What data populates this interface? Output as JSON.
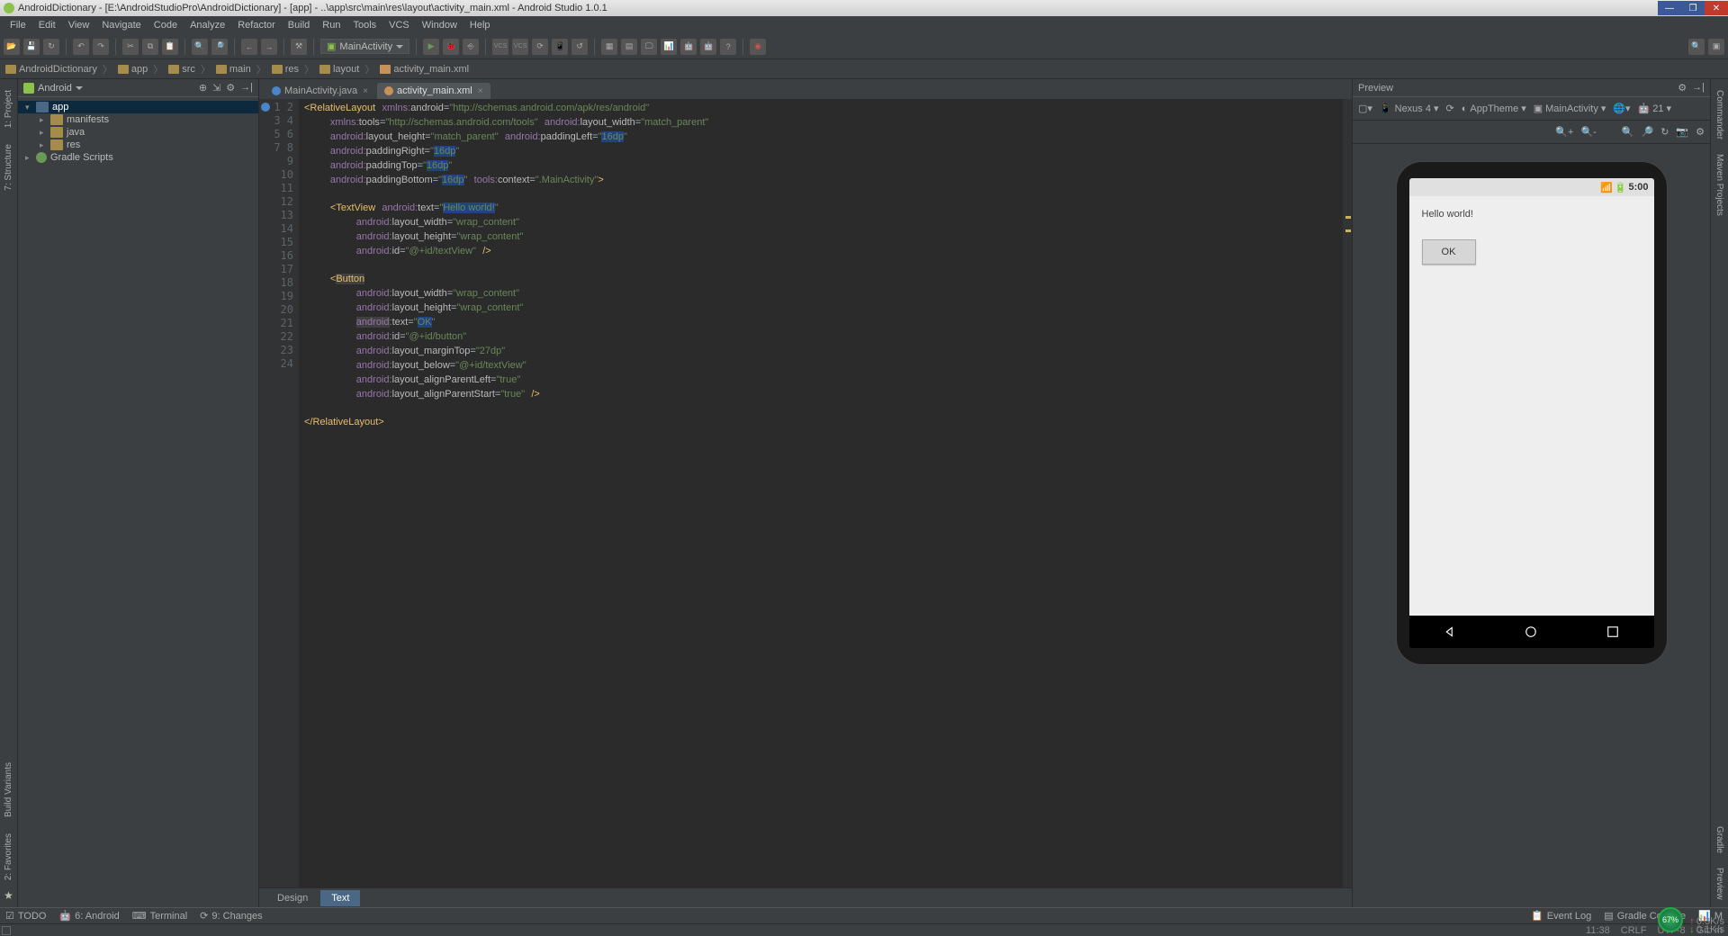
{
  "titlebar": {
    "text": "AndroidDictionary - [E:\\AndroidStudioPro\\AndroidDictionary] - [app] - ..\\app\\src\\main\\res\\layout\\activity_main.xml - Android Studio 1.0.1"
  },
  "menu": [
    "File",
    "Edit",
    "View",
    "Navigate",
    "Code",
    "Analyze",
    "Refactor",
    "Build",
    "Run",
    "Tools",
    "VCS",
    "Window",
    "Help"
  ],
  "toolbar": {
    "run_config": "MainActivity"
  },
  "breadcrumb": [
    "AndroidDictionary",
    "app",
    "src",
    "main",
    "res",
    "layout",
    "activity_main.xml"
  ],
  "project": {
    "scope": "Android",
    "tree": {
      "root": "app",
      "children": [
        "manifests",
        "java",
        "res"
      ],
      "gradle": "Gradle Scripts"
    }
  },
  "tabs": [
    {
      "name": "MainActivity.java",
      "icon": "java",
      "active": false
    },
    {
      "name": "activity_main.xml",
      "icon": "xml",
      "active": true
    }
  ],
  "code_lines": 24,
  "editor_bottom": {
    "design": "Design",
    "text": "Text"
  },
  "preview": {
    "title": "Preview",
    "device": "Nexus 4",
    "theme": "AppTheme",
    "activity": "MainActivity",
    "api": "21",
    "status_time": "5:00",
    "hello": "Hello world!",
    "ok": "OK"
  },
  "left_tabs": [
    "1: Project",
    "7: Structure",
    "Build Variants",
    "2: Favorites"
  ],
  "right_tabs": [
    "Commander",
    "Maven Projects",
    "Gradle",
    "Preview"
  ],
  "bottom_tools": {
    "left": [
      "TODO",
      "6: Android",
      "Terminal",
      "9: Changes"
    ],
    "right": [
      "Event Log",
      "Gradle Console",
      "M"
    ]
  },
  "status": {
    "time": "11:38",
    "crlf": "CRLF",
    "enc": "UTF-8",
    "git": "Git: m",
    "cpu": "67%",
    "net_up": "0.3K/s",
    "net_dn": "0.1K/s"
  }
}
